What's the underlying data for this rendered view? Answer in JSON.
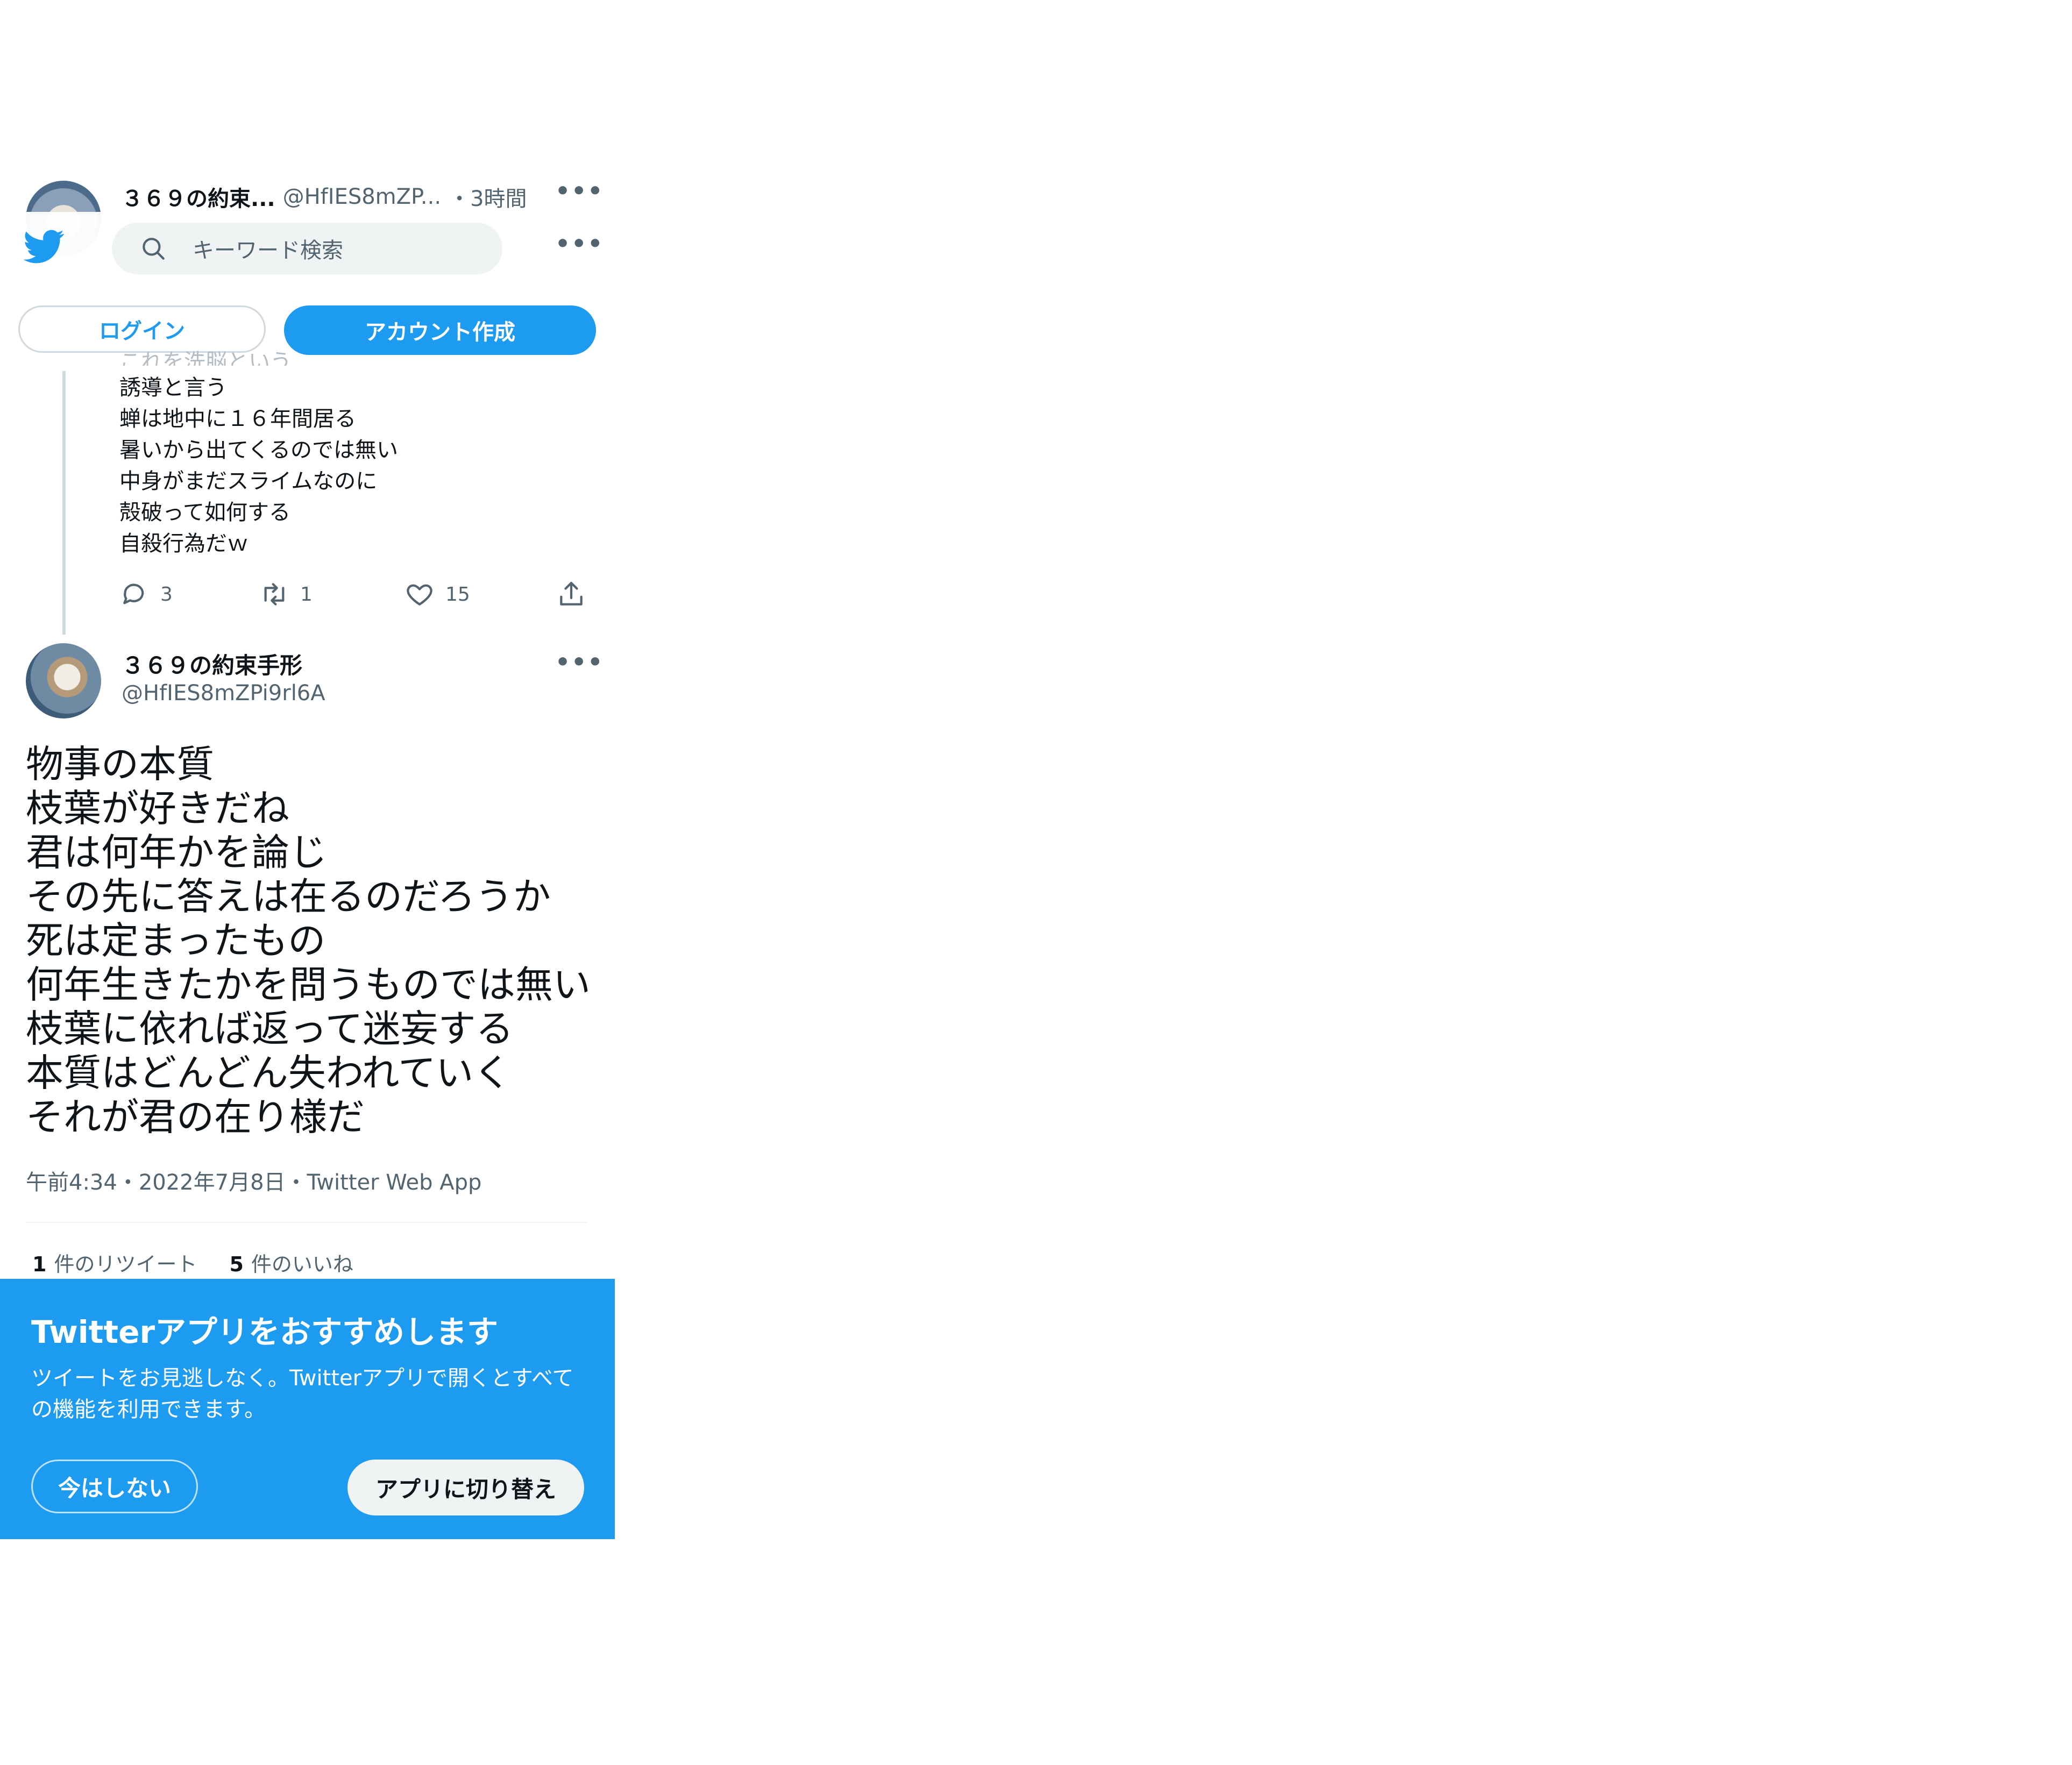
{
  "colors": {
    "accent": "#1d9bf0",
    "text_primary": "#0f1419",
    "text_secondary": "#536471",
    "divider": "#eff3f4",
    "promo_background": "#1d9bf0"
  },
  "header": {
    "logo_icon": "twitter-bird-icon",
    "search": {
      "icon": "search-icon",
      "placeholder": "キーワード検索"
    },
    "more_icon": "more-horizontal-icon",
    "login_label": "ログイン",
    "signup_label": "アカウント作成"
  },
  "parent_tweet": {
    "display_name": "３６９の約束...",
    "handle": "@HfIES8mZP...",
    "time": "・3時間",
    "faded_line": "これを洗脳という",
    "lines": [
      "誘導と言う",
      "蝉は地中に１６年間居る",
      "暑いから出てくるのでは無い",
      "中身がまだスライムなのに",
      "殻破って如何する",
      "自殺行為だｗ"
    ],
    "actions": {
      "replies": "3",
      "retweets": "1",
      "likes": "15"
    }
  },
  "main_tweet": {
    "display_name": "３６９の約束手形",
    "handle": "@HfIES8mZPi9rl6A",
    "lines": [
      "物事の本質",
      "枝葉が好きだね",
      "君は何年かを論じ",
      "その先に答えは在るのだろうか",
      "死は定まったもの",
      "何年生きたかを問うものでは無い",
      "枝葉に依れば返って迷妄する",
      "本質はどんどん失われていく",
      "それが君の在り様だ"
    ],
    "meta": {
      "time": "午前4:34",
      "sep1": "・",
      "date": "2022年7月8日",
      "sep2": "・",
      "source": "Twitter Web App"
    },
    "stats": {
      "retweets_count": "1",
      "retweets_label": "件のリツイート",
      "likes_count": "5",
      "likes_label": "件のいいね"
    }
  },
  "promo": {
    "title": "Twitterアプリをおすすめします",
    "description": "ツイートをお見逃しなく。Twitterアプリで開くとすべての機能を利用できます。",
    "dismiss_label": "今はしない",
    "switch_label": "アプリに切り替え"
  }
}
